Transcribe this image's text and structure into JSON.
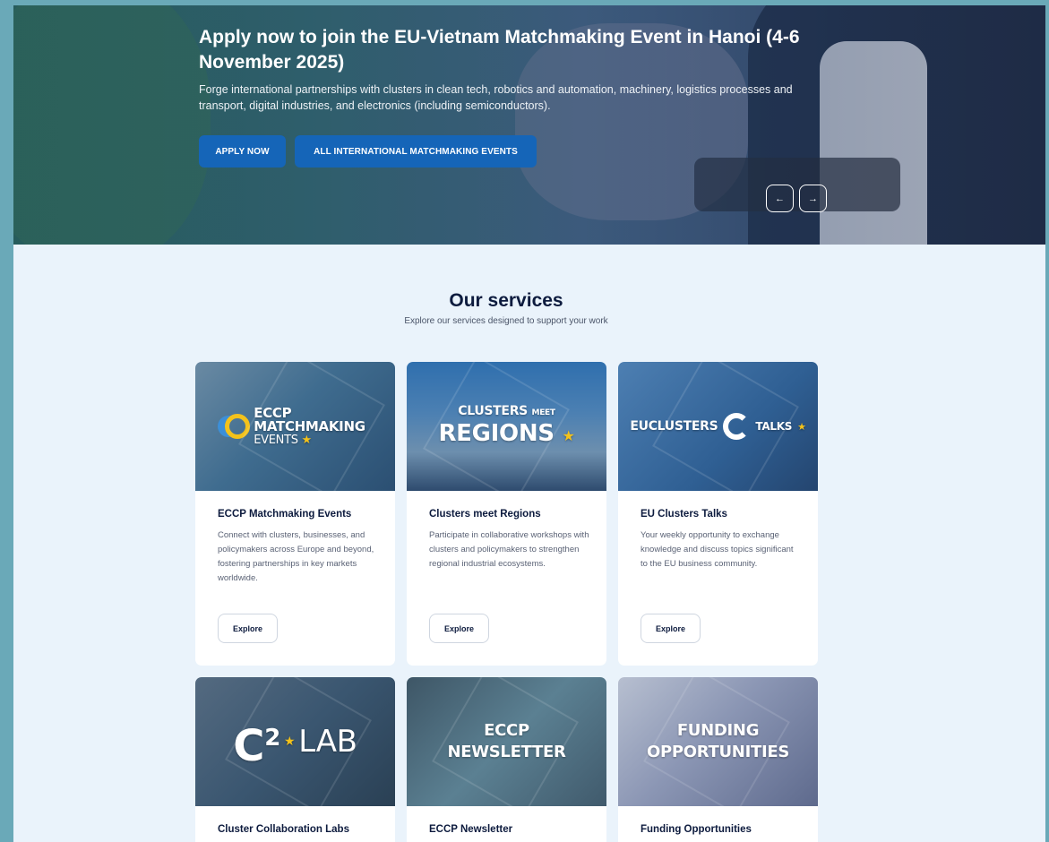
{
  "hero": {
    "title": "Apply now to join the EU-Vietnam Matchmaking Event in Hanoi (4-6 November 2025)",
    "description": "Forge international partnerships with clusters in clean tech, robotics and automation, machinery, logistics processes and transport, digital industries, and electronics (including semiconductors).",
    "apply_label": "APPLY NOW",
    "all_events_label": "ALL INTERNATIONAL MATCHMAKING EVENTS",
    "prev_icon": "←",
    "next_icon": "→"
  },
  "services": {
    "title": "Our services",
    "subtitle": "Explore our services designed to support your work",
    "cards": [
      {
        "banner_line1": "ECCP",
        "banner_line2": "MATCHMAKING",
        "banner_line3": "EVENTS",
        "title": "ECCP Matchmaking Events",
        "description": "Connect with clusters, businesses, and policymakers across Europe and beyond, fostering partnerships in key markets worldwide.",
        "button": "Explore"
      },
      {
        "banner_line1": "CLUSTERS",
        "banner_line1b": "MEET",
        "banner_line2": "REGIONS",
        "title": "Clusters meet Regions",
        "description": "Participate in collaborative workshops with clusters and policymakers to strengthen regional industrial ecosystems.",
        "button": "Explore"
      },
      {
        "banner_line1": "EUCLUSTERS",
        "banner_line2": "TALKS",
        "title": "EU Clusters Talks",
        "description": "Your weekly opportunity to exchange knowledge and discuss topics significant to the EU business community.",
        "button": "Explore"
      },
      {
        "banner_line1": "C",
        "banner_sup": "2",
        "banner_line2": "LAB",
        "title": "Cluster Collaboration Labs"
      },
      {
        "banner_line1": "ECCP",
        "banner_line2": "NEWSLETTER",
        "title": "ECCP Newsletter"
      },
      {
        "banner_line1": "FUNDING",
        "banner_line2": "OPPORTUNITIES",
        "title": "Funding Opportunities"
      }
    ]
  },
  "colors": {
    "primary_button": "#1565b8",
    "heading": "#0d1b3e",
    "page_bg": "#eaf3fb",
    "frame": "#6aa9b8",
    "star": "#f3c21b"
  }
}
